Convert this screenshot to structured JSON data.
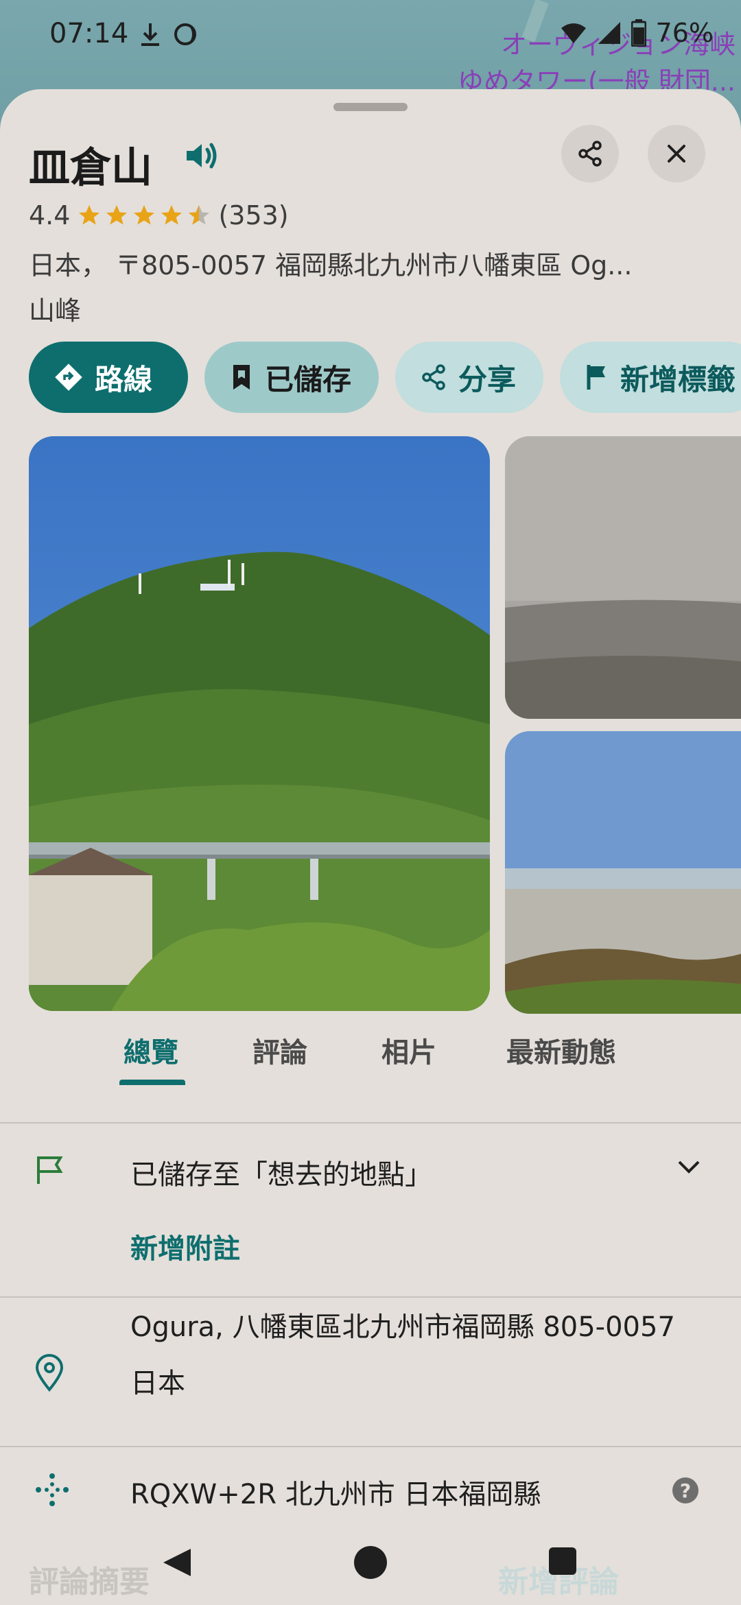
{
  "status_bar": {
    "time": "07:14",
    "battery": "76%"
  },
  "map": {
    "label_1": "オーヴィジョン海峡",
    "label_2": "ゆめタワー(一般 財団..."
  },
  "place": {
    "title": "皿倉山",
    "rating": "4.4",
    "stars": 4.5,
    "review_count": "(353)",
    "address_line": "日本， 〒805-0057 福岡縣北九州市八幡東區 Og...",
    "category": "山峰"
  },
  "chips": {
    "directions": "路線",
    "saved": "已儲存",
    "share": "分享",
    "add_label": "新增標籤"
  },
  "tabs": {
    "overview": "總覽",
    "reviews": "評論",
    "photos": "相片",
    "updates": "最新動態"
  },
  "details": {
    "saved_to": "已儲存至「想去的地點」",
    "add_note": "新增附註",
    "address_line1": "Ogura, 八幡東區北九州市福岡縣 805-0057",
    "address_line2": "日本",
    "plus_code": "RQXW+2R 北九州市 日本福岡縣"
  },
  "bottom": {
    "review_summary": "評論摘要",
    "add_review": "新增評論"
  },
  "colors": {
    "accent": "#0e6e6e",
    "star": "#e8a317",
    "sheet_bg": "#e4dfda",
    "map_label": "#8a3fb8"
  }
}
